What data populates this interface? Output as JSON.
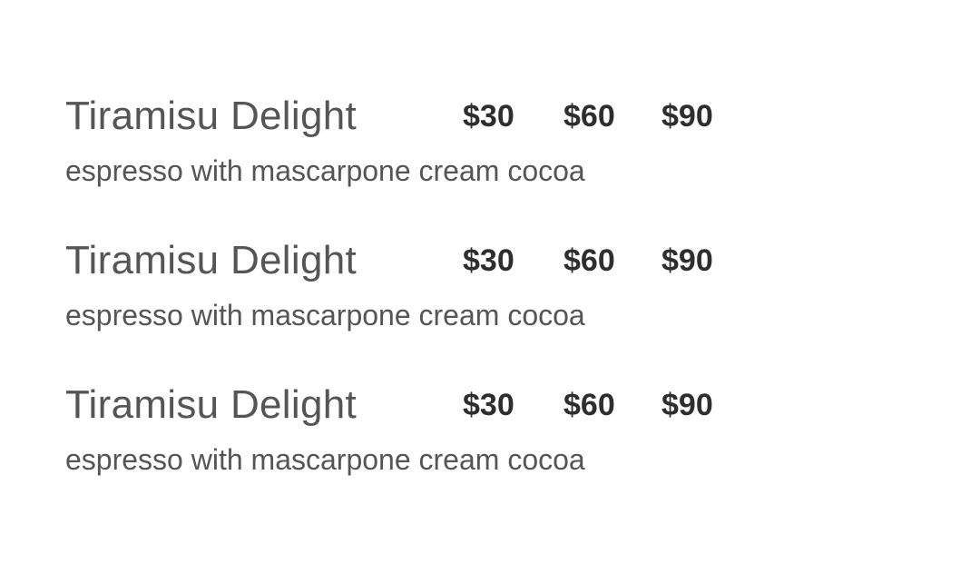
{
  "menu": {
    "items": [
      {
        "title": "Tiramisu Delight",
        "description": "espresso with mascarpone cream cocoa",
        "prices": [
          "$30",
          "$60",
          "$90"
        ]
      },
      {
        "title": "Tiramisu Delight",
        "description": "espresso with mascarpone cream cocoa",
        "prices": [
          "$30",
          "$60",
          "$90"
        ]
      },
      {
        "title": "Tiramisu Delight",
        "description": "espresso with mascarpone cream cocoa",
        "prices": [
          "$30",
          "$60",
          "$90"
        ]
      }
    ]
  }
}
